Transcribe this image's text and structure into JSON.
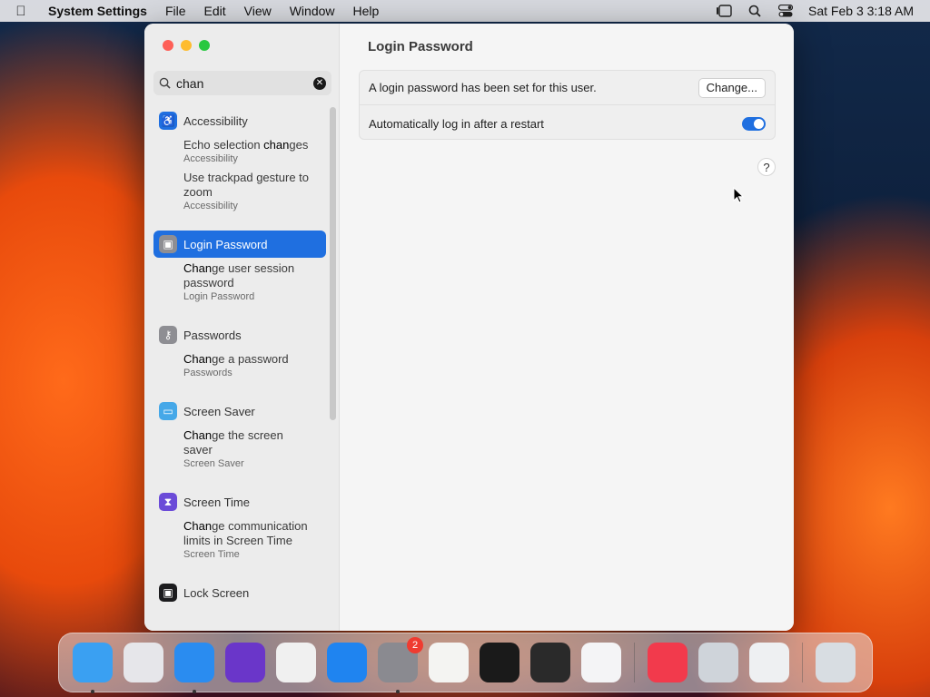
{
  "menubar": {
    "app_name": "System Settings",
    "items": [
      "File",
      "Edit",
      "View",
      "Window",
      "Help"
    ],
    "clock": "Sat Feb 3  3:18 AM",
    "status_icons": [
      "stage-manager-icon",
      "spotlight-icon",
      "control-center-icon"
    ]
  },
  "sidebar": {
    "search": {
      "value": "chan",
      "placeholder": "Search"
    },
    "categories": [
      {
        "label": "Accessibility",
        "icon": "accessibility-icon",
        "color": "#1f6fe0",
        "results": [
          {
            "pre": "Echo selection ",
            "match": "chan",
            "post": "ges",
            "sub": "Accessibility"
          },
          {
            "pre": "Use trackpad gesture to zoom",
            "match": "",
            "post": "",
            "sub": "Accessibility"
          }
        ]
      },
      {
        "label": "Login Password",
        "icon": "lock-icon",
        "color": "#8e8e93",
        "selected": true,
        "results": [
          {
            "pre": "",
            "match": "Chan",
            "post": "ge user session password",
            "sub": "Login Password"
          }
        ]
      },
      {
        "label": "Passwords",
        "icon": "key-icon",
        "color": "#8e8e93",
        "results": [
          {
            "pre": "",
            "match": "Chan",
            "post": "ge a password",
            "sub": "Passwords"
          }
        ]
      },
      {
        "label": "Screen Saver",
        "icon": "screen-saver-icon",
        "color": "#46a8e8",
        "results": [
          {
            "pre": "",
            "match": "Chan",
            "post": "ge the screen saver",
            "sub": "Screen Saver"
          }
        ]
      },
      {
        "label": "Screen Time",
        "icon": "hourglass-icon",
        "color": "#6b4bd8",
        "results": [
          {
            "pre": "",
            "match": "Chan",
            "post": "ge communication limits in Screen Time",
            "sub": "Screen Time"
          }
        ]
      },
      {
        "label": "Lock Screen",
        "icon": "lock-icon",
        "color": "#1c1c1e",
        "results": []
      }
    ]
  },
  "main": {
    "title": "Login Password",
    "row1_text": "A login password has been set for this user.",
    "change_button": "Change...",
    "row2_text": "Automatically log in after a restart",
    "auto_login_on": true,
    "help": "?"
  },
  "dock": {
    "apps": [
      {
        "name": "finder-icon",
        "color": "#3aa0f2",
        "running": true
      },
      {
        "name": "launchpad-icon",
        "color": "#e6e6ea",
        "running": false
      },
      {
        "name": "safari-icon",
        "color": "#2a8cf0",
        "running": true
      },
      {
        "name": "firefox-icon",
        "color": "#6a36c9",
        "running": false
      },
      {
        "name": "chrome-icon",
        "color": "#f0f0f0",
        "running": false
      },
      {
        "name": "app-store-icon",
        "color": "#1f84f0",
        "running": false
      },
      {
        "name": "system-settings-icon",
        "color": "#8a8a90",
        "running": true,
        "badge": "2"
      },
      {
        "name": "textedit-icon",
        "color": "#f4f4f2",
        "running": false
      },
      {
        "name": "terminal-icon",
        "color": "#1a1a1a",
        "running": false
      },
      {
        "name": "garageband-icon",
        "color": "#2a2a2a",
        "running": false
      },
      {
        "name": "vscode-icon",
        "color": "#f4f4f6",
        "running": false
      },
      {
        "name": "music-icon",
        "color": "#f23a4c",
        "running": false
      },
      {
        "name": "migration-assistant-icon",
        "color": "#cfd4da",
        "running": false
      },
      {
        "name": "system-information-icon",
        "color": "#eef0f2",
        "running": false
      },
      {
        "name": "trash-icon",
        "color": "#d8dde2",
        "running": false
      }
    ]
  }
}
